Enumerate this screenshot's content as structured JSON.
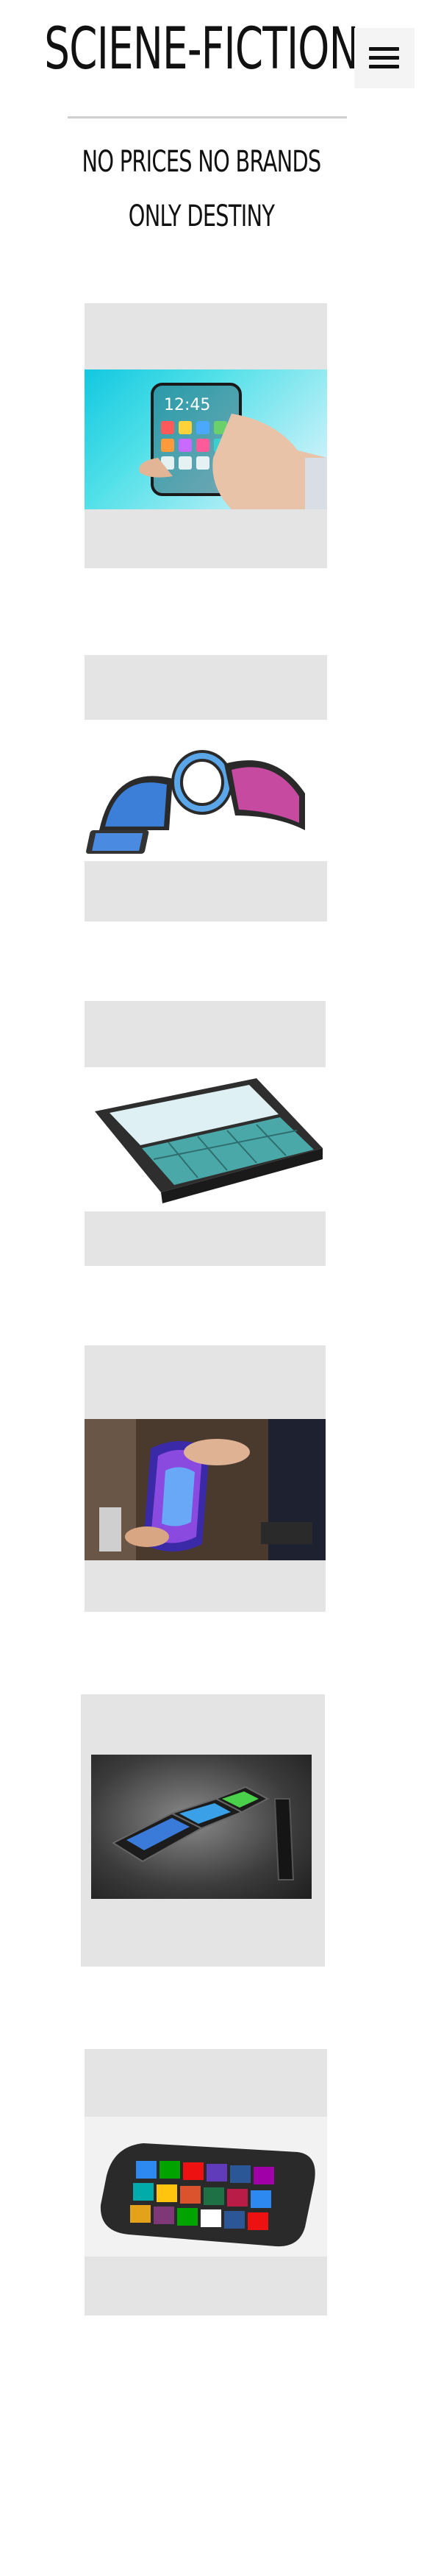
{
  "header": {
    "title": "SCIENE-FICTION",
    "menu_icon": "hamburger-menu-icon"
  },
  "tagline": {
    "line1": "NO PRICES NO BRANDS",
    "line2": "ONLY DESTINY"
  },
  "gallery": {
    "items": [
      {
        "subject": "transparent-phone-in-hand"
      },
      {
        "subject": "flexible-bracelet-phones"
      },
      {
        "subject": "sliding-keyboard-phone"
      },
      {
        "subject": "bendable-display-in-hand"
      },
      {
        "subject": "folding-concept-phone"
      },
      {
        "subject": "windows-concept-phone"
      }
    ]
  },
  "colors": {
    "card_background": "#e4e4e4",
    "menu_background": "#f4f4f4",
    "divider": "#cfcfcf",
    "text": "#111111"
  }
}
